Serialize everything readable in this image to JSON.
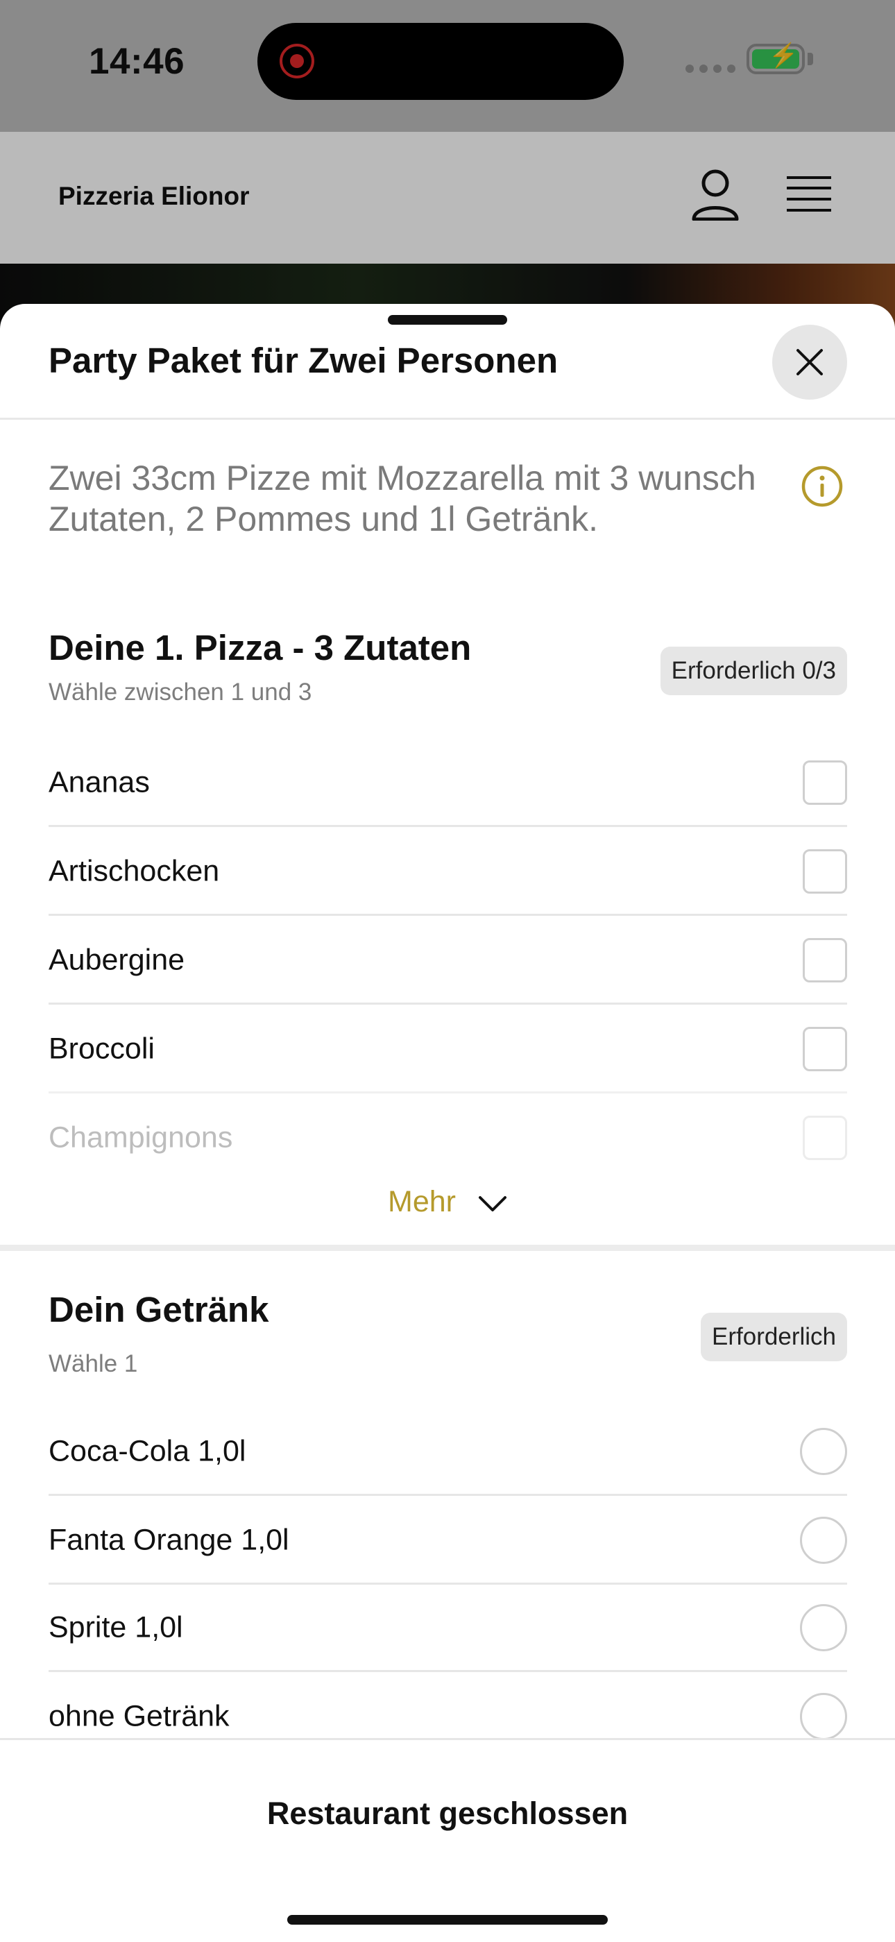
{
  "status_bar": {
    "time": "14:46"
  },
  "header": {
    "brand": "Pizzeria Elionor"
  },
  "sheet": {
    "title": "Party Paket für Zwei Personen",
    "description": "Zwei 33cm Pizze mit Mozzarella mit 3 wunsch Zutaten, 2 Pommes und 1l Getränk."
  },
  "group_pizza": {
    "title": "Deine 1. Pizza - 3 Zutaten",
    "subtitle": "Wähle zwischen 1 und 3",
    "badge": "Erforderlich 0/3",
    "options": [
      "Ananas",
      "Artischocken",
      "Aubergine",
      "Broccoli",
      "Champignons"
    ],
    "more_label": "Mehr"
  },
  "group_drink": {
    "title": "Dein Getränk",
    "subtitle": "Wähle 1",
    "badge": "Erforderlich",
    "options": [
      "Coca-Cola 1,0l",
      "Fanta Orange 1,0l",
      "Sprite 1,0l",
      "ohne Getränk"
    ]
  },
  "footer": {
    "status": "Restaurant geschlossen"
  },
  "colors": {
    "accent": "#b59a2c",
    "badge_bg": "#e6e6e6",
    "battery": "#37c759"
  }
}
